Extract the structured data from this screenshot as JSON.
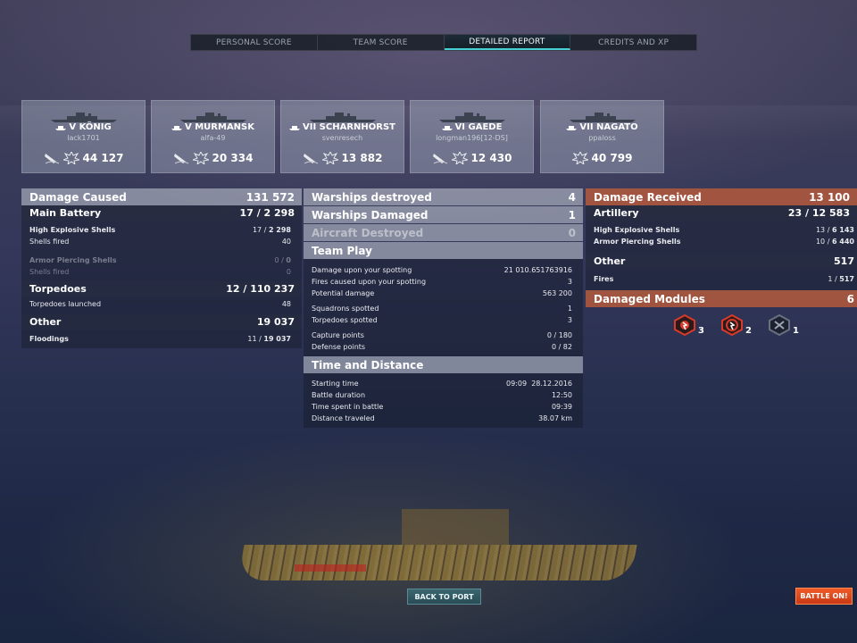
{
  "tabs": [
    {
      "label": "PERSONAL SCORE"
    },
    {
      "label": "TEAM SCORE"
    },
    {
      "label": "DETAILED REPORT",
      "active": true
    },
    {
      "label": "CREDITS AND XP"
    }
  ],
  "ships": [
    {
      "tier": "V",
      "name": "KÖNIG",
      "player": "lack1701",
      "damage": "44 127",
      "sunk_icon": true
    },
    {
      "tier": "V",
      "name": "MURMANSK",
      "player": "alfa-49",
      "damage": "20 334",
      "sunk_icon": true
    },
    {
      "tier": "VII",
      "name": "SCHARNHORST",
      "player": "svenresech",
      "damage": "13 882",
      "sunk_icon": true
    },
    {
      "tier": "VI",
      "name": "GAEDE",
      "player": "longman196[12-DS]",
      "damage": "12 430",
      "sunk_icon": true
    },
    {
      "tier": "VII",
      "name": "NAGATO",
      "player": "ppaloss",
      "damage": "40 799",
      "sunk_icon": false
    }
  ],
  "damage_caused": {
    "title": "Damage Caused",
    "total": "131 572",
    "main_battery": {
      "label": "Main Battery",
      "hits": "17",
      "value": "2 298"
    },
    "he": {
      "label": "High Explosive Shells",
      "hits": "17",
      "value": "2 298"
    },
    "he_fired": {
      "label": "Shells fired",
      "value": "40"
    },
    "ap": {
      "label": "Armor Piercing Shells",
      "hits": "0",
      "value": "0"
    },
    "ap_fired": {
      "label": "Shells fired",
      "value": "0"
    },
    "torpedoes": {
      "label": "Torpedoes",
      "hits": "12",
      "value": "110 237"
    },
    "torp_launched": {
      "label": "Torpedoes launched",
      "value": "48"
    },
    "other": {
      "label": "Other",
      "value": "19 037"
    },
    "floodings": {
      "label": "Floodings",
      "hits": "11",
      "value": "19 037"
    }
  },
  "middle": {
    "warships_destroyed": {
      "label": "Warships destroyed",
      "value": "4"
    },
    "warships_damaged": {
      "label": "Warships Damaged",
      "value": "1"
    },
    "aircraft_destroyed": {
      "label": "Aircraft Destroyed",
      "value": "0"
    },
    "team_play": {
      "title": "Team Play",
      "damage_spotting": {
        "label": "Damage upon your spotting",
        "value": "21 010.651763916"
      },
      "fires_spotting": {
        "label": "Fires caused upon your spotting",
        "value": "3"
      },
      "potential_damage": {
        "label": "Potential damage",
        "value": "563 200"
      },
      "squadrons_spotted": {
        "label": "Squadrons spotted",
        "value": "1"
      },
      "torpedoes_spotted": {
        "label": "Torpedoes spotted",
        "value": "3"
      },
      "capture_points": {
        "label": "Capture points",
        "value": "0 / 180"
      },
      "defense_points": {
        "label": "Defense points",
        "value": "0 / 82"
      }
    },
    "time_distance": {
      "title": "Time and Distance",
      "starting_time": {
        "label": "Starting time",
        "value": "09:09  28.12.2016"
      },
      "battle_duration": {
        "label": "Battle duration",
        "value": "12:50"
      },
      "time_in_battle": {
        "label": "Time spent in battle",
        "value": "09:39"
      },
      "distance": {
        "label": "Distance traveled",
        "value": "38.07 km"
      }
    }
  },
  "damage_received": {
    "title": "Damage Received",
    "total": "13 100",
    "artillery": {
      "label": "Artillery",
      "hits": "23",
      "value": "12 583"
    },
    "he": {
      "label": "High Explosive Shells",
      "hits": "13",
      "value": "6 143"
    },
    "ap": {
      "label": "Armor Piercing Shells",
      "hits": "10",
      "value": "6 440"
    },
    "other": {
      "label": "Other",
      "value": "517"
    },
    "fires": {
      "label": "Fires",
      "hits": "1",
      "value": "517"
    }
  },
  "damaged_modules": {
    "title": "Damaged Modules",
    "total": "6",
    "items": [
      {
        "icon": "engine-damage-icon",
        "count": "3",
        "color": "#d83a2a"
      },
      {
        "icon": "steering-damage-icon",
        "count": "2",
        "color": "#d83a2a"
      },
      {
        "icon": "turret-destroyed-icon",
        "count": "1",
        "color": "#6a7080"
      }
    ]
  },
  "buttons": {
    "back_to_port": "BACK TO PORT",
    "battle_on": "BATTLE ON!"
  }
}
